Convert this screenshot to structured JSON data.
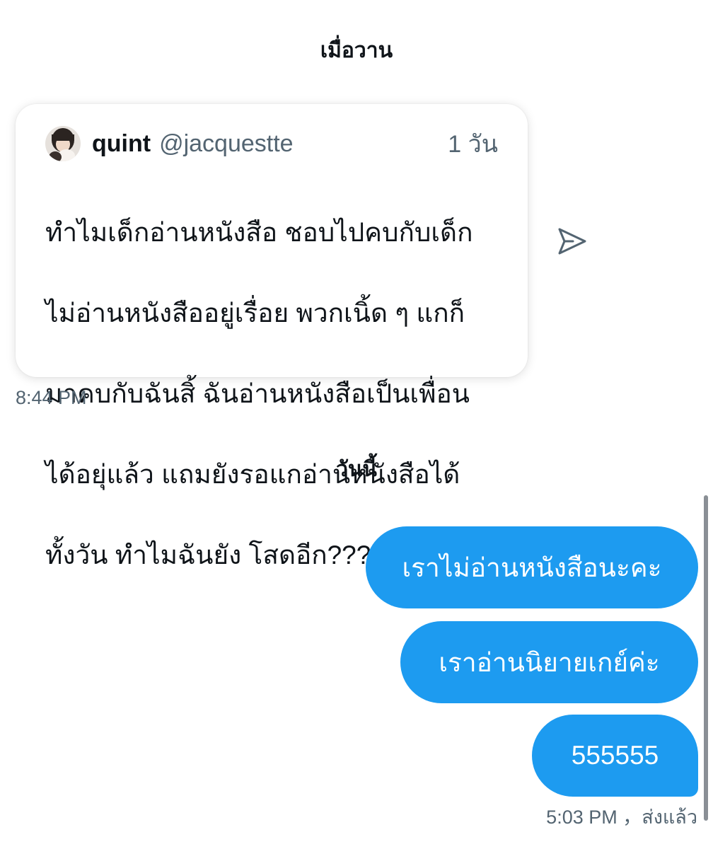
{
  "day_separators": {
    "yesterday": "เมื่อวาน",
    "today": "วันนี้"
  },
  "shared_tweet": {
    "author_name": "quint",
    "author_handle": "@jacquestte",
    "age": "1 วัน",
    "text_lines": [
      "ทำไมเด็กอ่านหนังสือ ชอบไปคบกับเด็ก",
      "ไม่อ่านหนังสืออยู่เรื่อย พวกเนิ้ด ๆ แกก็",
      "มาคบกับฉันสิ้ ฉันอ่านหนังสือเป็นเพื่อน",
      "ได้อยุ่แล้ว แถมยังรอแกอ่านหนังสือได้",
      "ทั้งวัน ทำไมฉันยัง โสดอีก????"
    ],
    "avatar_icon": "profile-photo",
    "share_icon": "send-arrow-icon"
  },
  "received_time": "8:44 PM",
  "sent_messages": [
    "เราไม่อ่านหนังสือนะคะ",
    "เราอ่านนิยายเกย์ค่ะ",
    "555555"
  ],
  "sent_status": "5:03 PM ，ส่งแล้ว",
  "colors": {
    "bubble_blue": "#1d9bf0",
    "secondary_text": "#536471",
    "primary_text": "#0f1419"
  }
}
